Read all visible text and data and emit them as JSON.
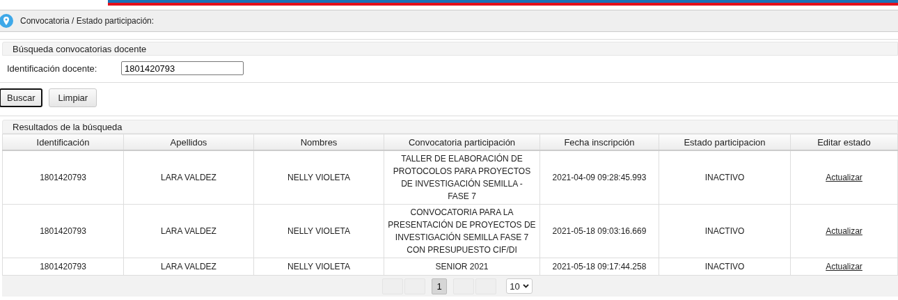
{
  "breadcrumb": "Convocatoria / Estado participación:",
  "search_panel": {
    "title": "Búsqueda convocatorias docente",
    "field_label": "Identificación docente:",
    "field_value": "1801420793"
  },
  "buttons": [
    {
      "label": "Buscar",
      "selected": true
    },
    {
      "label": "Limpiar",
      "selected": false
    }
  ],
  "results": {
    "title": "Resultados de la búsqueda",
    "columns": [
      "Identificación",
      "Apellidos",
      "Nombres",
      "Convocatoria participación",
      "Fecha inscripción",
      "Estado participacion",
      "Editar estado"
    ],
    "rows": [
      {
        "id": "1801420793",
        "apellidos": "LARA VALDEZ",
        "nombres": "NELLY VIOLETA",
        "convocatoria": [
          "TALLER DE ELABORACIÓN DE",
          "PROTOCOLOS PARA PROYECTOS",
          "DE INVESTIGACIÓN SEMILLA -",
          "FASE 7"
        ],
        "fecha": "2021-04-09 09:28:45.993",
        "estado": "INACTIVO",
        "accion": "Actualizar"
      },
      {
        "id": "1801420793",
        "apellidos": "LARA VALDEZ",
        "nombres": "NELLY VIOLETA",
        "convocatoria": [
          "CONVOCATORIA PARA LA",
          "PRESENTACIÓN DE PROYECTOS DE",
          "INVESTIGACIÓN SEMILLA FASE 7",
          "CON PRESUPUESTO CIF/DI"
        ],
        "fecha": "2021-05-18 09:03:16.669",
        "estado": "INACTIVO",
        "accion": "Actualizar"
      },
      {
        "id": "1801420793",
        "apellidos": "LARA VALDEZ",
        "nombres": "NELLY VIOLETA",
        "convocatoria": [
          "SENIOR 2021"
        ],
        "fecha": "2021-05-18 09:17:44.258",
        "estado": "INACTIVO",
        "accion": "Actualizar"
      }
    ]
  },
  "pagination": {
    "pages": [
      {
        "label": "1",
        "selected": true
      }
    ],
    "page_size": "10"
  }
}
